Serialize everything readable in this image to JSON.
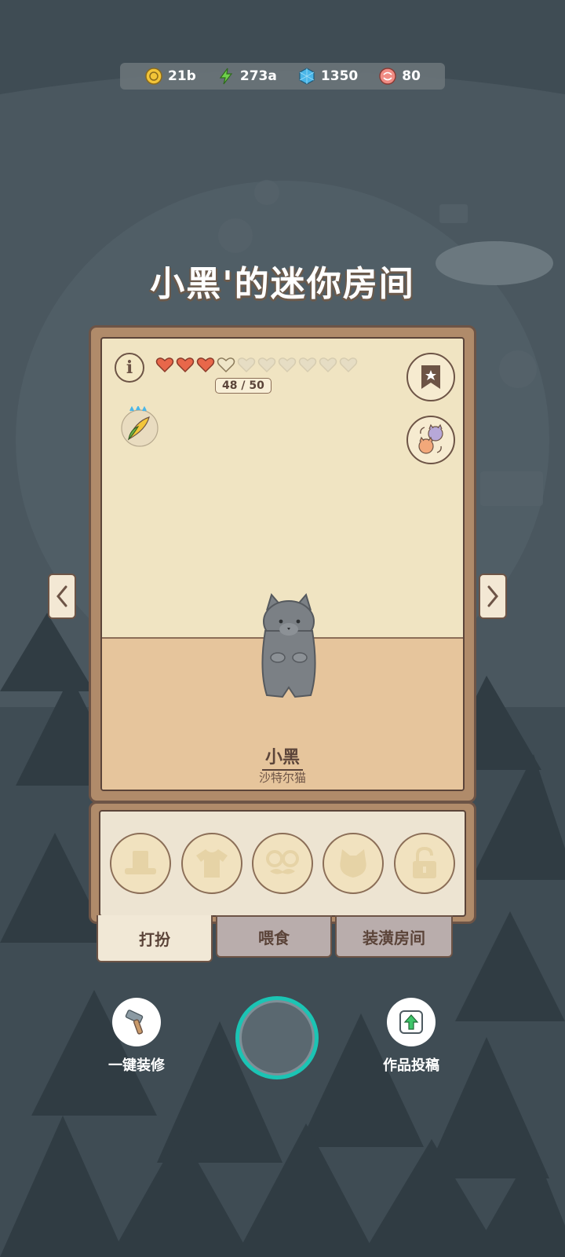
{
  "resources": [
    {
      "icon": "coin-icon",
      "value": "21b"
    },
    {
      "icon": "energy-bolt-icon",
      "value": "273a"
    },
    {
      "icon": "blue-gem-icon",
      "value": "1350"
    },
    {
      "icon": "candy-icon",
      "value": "80"
    }
  ],
  "room": {
    "title": "小黑'的迷你房间",
    "xp": "48 / 50",
    "hearts_filled": 3,
    "hearts_partial": 1,
    "hearts_total": 10
  },
  "pet": {
    "name": "小黑",
    "breed": "沙特尔猫"
  },
  "tabs": [
    {
      "label": "打扮"
    },
    {
      "label": "喂食"
    },
    {
      "label": "装潢房间"
    }
  ],
  "actions": {
    "renovate_label": "一键装修",
    "submit_label": "作品投稿"
  },
  "colors": {
    "background": "#3b4850",
    "frame": "#b08b6a",
    "heart_red": "#e8674a",
    "accent_teal": "#1bc4b4"
  }
}
